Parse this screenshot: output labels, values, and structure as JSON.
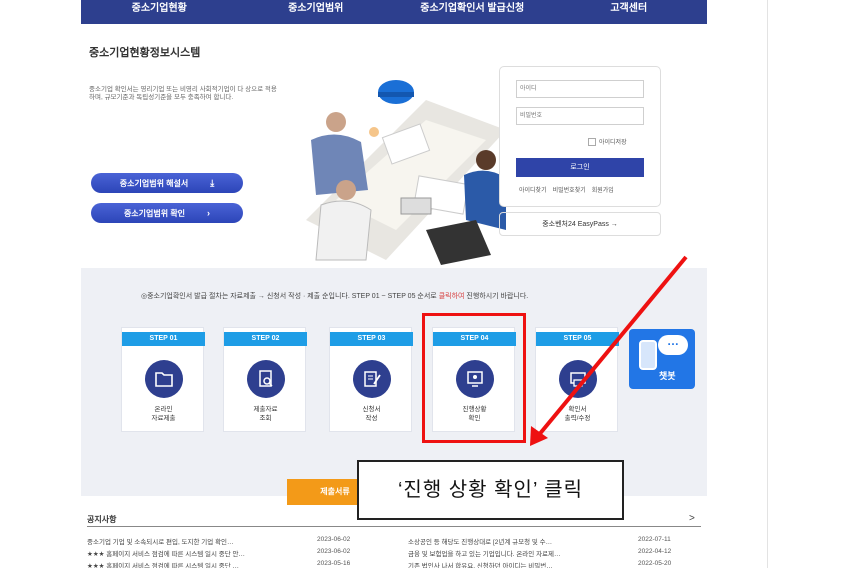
{
  "nav": [
    "중소기업현황",
    "중소기업범위",
    "중소기업확인서 발급신청",
    "고객센터"
  ],
  "system_title": "중소기업현황정보시스템",
  "intro_text": "중소기업 확인서는 영리기업 또는 비영리 사회적기업이 다 상으로 적용하며, 규모기준과 독립성기준을 모두 충족하여 합니다.",
  "buttons": {
    "guide": "중소기업범위 해설서",
    "check": "중소기업범위 확인"
  },
  "login": {
    "id_placeholder": "아이디",
    "pw_placeholder": "비밀번호",
    "save_id": "아이디저장",
    "submit": "로그인",
    "links": [
      "아이디찾기",
      "비밀번호찾기",
      "회원가입"
    ]
  },
  "easypass": "중소벤처24 EasyPass →",
  "step_intro": {
    "prefix": "◎중소기업확인서 발급 절차는 자료제출 → 신청서 작성 · 제출 순입니다. STEP 01 ~ STEP 05 순서로 ",
    "highlight": "클릭하여",
    "suffix": " 진행하시기 바랍니다."
  },
  "steps": [
    {
      "tag": "STEP 01",
      "label": "온라인\n자료제출",
      "icon": "folder-icon"
    },
    {
      "tag": "STEP 02",
      "label": "제출자료\n조회",
      "icon": "document-search-icon"
    },
    {
      "tag": "STEP 03",
      "label": "신청서\n작성",
      "icon": "edit-form-icon"
    },
    {
      "tag": "STEP 04",
      "label": "진행상황\n확인",
      "icon": "progress-monitor-icon"
    },
    {
      "tag": "STEP 05",
      "label": "확인서\n출력/수정",
      "icon": "print-icon"
    }
  ],
  "chatbot_label": "챗봇",
  "submit_button": "제출서류",
  "callout": "‘진행 상황 확인’ 클릭",
  "notices": {
    "title": "공지사항",
    "more": ">",
    "left": [
      {
        "text": "중소기업 기업 및 소속되시로 편입, 도지한 기업 확인…",
        "date": "2023-06-02"
      },
      {
        "text": "★★★ 홈페이지 서비스 점검에 따른 시스템 일시 중단 안…",
        "date": "2023-06-02"
      },
      {
        "text": "★★★ 홈페이지 서비스 점검에 따른 시스템 일시 중단 …",
        "date": "2023-05-16"
      }
    ],
    "right": [
      {
        "text": "소상공인 등 해당도 진행상대로 [2년계 규모청 및 수…",
        "date": "2022-07-11"
      },
      {
        "text": "금융 및 보험업을 하고 있는 기업입니다. 온라인 자료제…",
        "date": "2022-04-12"
      },
      {
        "text": "기존 법인사 나서 합유요, 신청하던 아이디는 비밀번…",
        "date": "2022-05-20"
      }
    ]
  },
  "colors": {
    "nav": "#2d3f8e",
    "step_tag": "#1e9de6",
    "annotation": "#ee1111",
    "accent": "#f39a18"
  }
}
